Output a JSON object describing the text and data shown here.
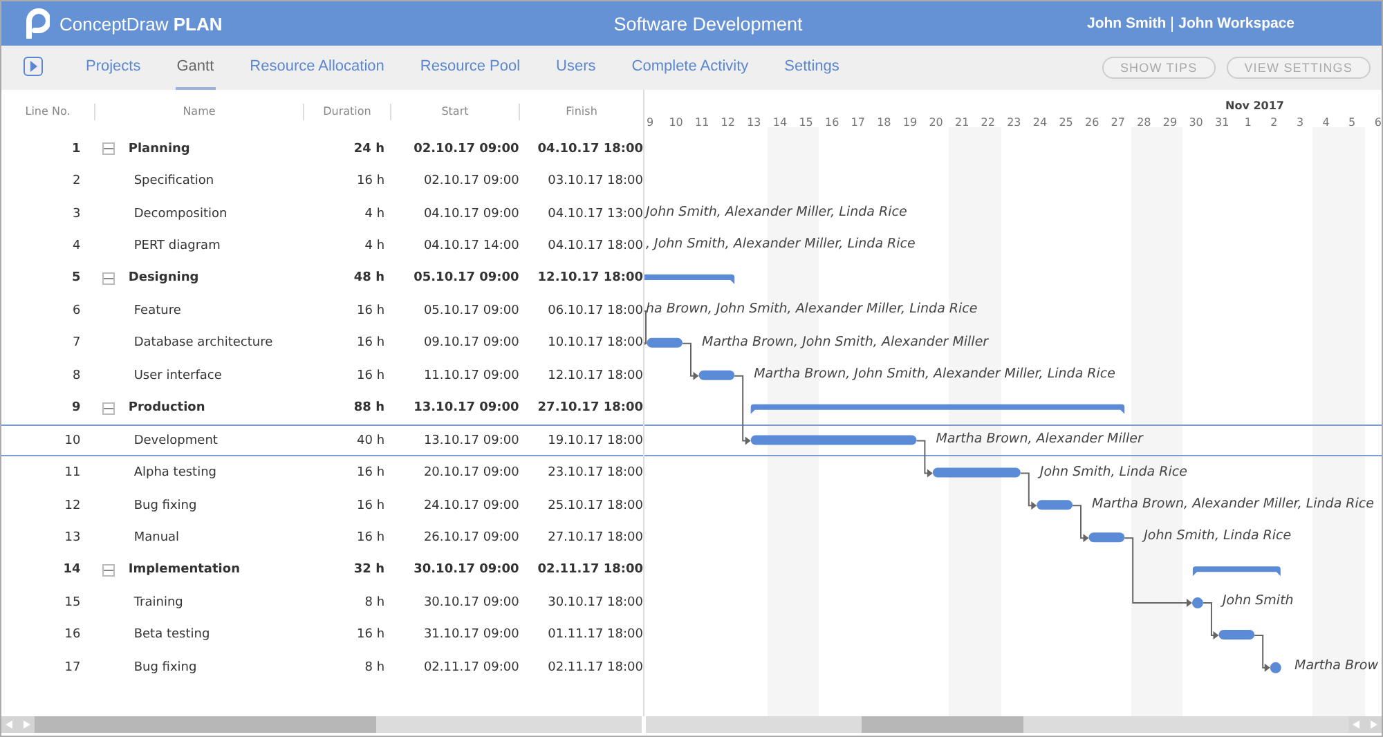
{
  "app": {
    "logo_text": "ConceptDraw",
    "logo_bold": "PLAN",
    "title": "Software Development",
    "user": "John Smith",
    "workspace": "John Workspace"
  },
  "nav": {
    "tabs": [
      {
        "label": "Projects",
        "selected": false
      },
      {
        "label": "Gantt",
        "selected": true
      },
      {
        "label": "Resource Allocation",
        "selected": false
      },
      {
        "label": "Resource Pool",
        "selected": false
      },
      {
        "label": "Users",
        "selected": false
      },
      {
        "label": "Complete Activity",
        "selected": false
      },
      {
        "label": "Settings",
        "selected": false
      }
    ],
    "buttons": [
      "SHOW TIPS",
      "VIEW SETTINGS"
    ]
  },
  "table": {
    "columns": [
      "Line No.",
      "Name",
      "Duration",
      "Start",
      "Finish"
    ],
    "rows": [
      {
        "line": "1",
        "name": "Planning",
        "duration": "24 h",
        "start": "02.10.17 09:00",
        "finish": "04.10.17 18:00",
        "kind": "summary",
        "expanded": true,
        "selected": false,
        "linked": false
      },
      {
        "line": "2",
        "name": "Specification",
        "duration": "16 h",
        "start": "02.10.17 09:00",
        "finish": "03.10.17 18:00",
        "kind": "task",
        "selected": false,
        "linked": false
      },
      {
        "line": "3",
        "name": "Decomposition",
        "duration": "4 h",
        "start": "04.10.17 09:00",
        "finish": "04.10.17 13:00",
        "kind": "task",
        "selected": false,
        "linked": false,
        "resources": "John Smith, Alexander Miller, Linda Rice"
      },
      {
        "line": "4",
        "name": "PERT diagram",
        "duration": "4 h",
        "start": "04.10.17 14:00",
        "finish": "04.10.17 18:00",
        "kind": "task",
        "selected": false,
        "linked": false,
        "resources": ", John Smith, Alexander Miller, Linda Rice"
      },
      {
        "line": "5",
        "name": "Designing",
        "duration": "48 h",
        "start": "05.10.17 09:00",
        "finish": "12.10.17 18:00",
        "kind": "summary",
        "expanded": true,
        "selected": false,
        "linked": false
      },
      {
        "line": "6",
        "name": "Feature",
        "duration": "16 h",
        "start": "05.10.17 09:00",
        "finish": "06.10.17 18:00",
        "kind": "task",
        "selected": false,
        "linked": false,
        "resources": "ha Brown, John Smith, Alexander Miller, Linda Rice"
      },
      {
        "line": "7",
        "name": "Database architecture",
        "duration": "16 h",
        "start": "09.10.17 09:00",
        "finish": "10.10.17 18:00",
        "kind": "task",
        "selected": false,
        "linked": true,
        "resources": "Martha Brown, John Smith, Alexander Miller"
      },
      {
        "line": "8",
        "name": "User interface",
        "duration": "16 h",
        "start": "11.10.17 09:00",
        "finish": "12.10.17 18:00",
        "kind": "task",
        "selected": false,
        "linked": true,
        "resources": "Martha Brown, John Smith, Alexander Miller, Linda Rice"
      },
      {
        "line": "9",
        "name": "Production",
        "duration": "88 h",
        "start": "13.10.17 09:00",
        "finish": "27.10.17 18:00",
        "kind": "summary",
        "expanded": true,
        "selected": false,
        "linked": false
      },
      {
        "line": "10",
        "name": "Development",
        "duration": "40 h",
        "start": "13.10.17 09:00",
        "finish": "19.10.17 18:00",
        "kind": "task",
        "selected": true,
        "linked": true,
        "resources": "Martha Brown, Alexander Miller"
      },
      {
        "line": "11",
        "name": "Alpha testing",
        "duration": "16 h",
        "start": "20.10.17 09:00",
        "finish": "23.10.17 18:00",
        "kind": "task",
        "selected": false,
        "linked": true,
        "resources": "John Smith, Linda Rice"
      },
      {
        "line": "12",
        "name": "Bug fixing",
        "duration": "16 h",
        "start": "24.10.17 09:00",
        "finish": "25.10.17 18:00",
        "kind": "task",
        "selected": false,
        "linked": true,
        "resources": "Martha Brown, Alexander Miller, Linda Rice"
      },
      {
        "line": "13",
        "name": "Manual",
        "duration": "16 h",
        "start": "26.10.17 09:00",
        "finish": "27.10.17 18:00",
        "kind": "task",
        "selected": false,
        "linked": true,
        "resources": "John Smith, Linda Rice"
      },
      {
        "line": "14",
        "name": "Implementation",
        "duration": "32 h",
        "start": "30.10.17 09:00",
        "finish": "02.11.17 18:00",
        "kind": "summary",
        "expanded": true,
        "selected": false,
        "linked": false
      },
      {
        "line": "15",
        "name": "Training",
        "duration": "8 h",
        "start": "30.10.17 09:00",
        "finish": "30.10.17 18:00",
        "kind": "milestone",
        "selected": false,
        "linked": true,
        "resources": "John Smith"
      },
      {
        "line": "16",
        "name": "Beta testing",
        "duration": "16 h",
        "start": "31.10.17 09:00",
        "finish": "01.11.17 18:00",
        "kind": "task",
        "selected": false,
        "linked": true
      },
      {
        "line": "17",
        "name": "Bug fixing",
        "duration": "8 h",
        "start": "02.11.17 09:00",
        "finish": "02.11.17 18:00",
        "kind": "milestone",
        "selected": false,
        "linked": true,
        "resources": "Martha Brow"
      }
    ]
  },
  "timeline": {
    "days": [
      {
        "label": "9",
        "weekend": false
      },
      {
        "label": "10",
        "weekend": false
      },
      {
        "label": "11",
        "weekend": false
      },
      {
        "label": "12",
        "weekend": false
      },
      {
        "label": "13",
        "weekend": false
      },
      {
        "label": "14",
        "weekend": true
      },
      {
        "label": "15",
        "weekend": true
      },
      {
        "label": "16",
        "weekend": false
      },
      {
        "label": "17",
        "weekend": false
      },
      {
        "label": "18",
        "weekend": false
      },
      {
        "label": "19",
        "weekend": false
      },
      {
        "label": "20",
        "weekend": false
      },
      {
        "label": "21",
        "weekend": true
      },
      {
        "label": "22",
        "weekend": true
      },
      {
        "label": "23",
        "weekend": false
      },
      {
        "label": "24",
        "weekend": false
      },
      {
        "label": "25",
        "weekend": false
      },
      {
        "label": "26",
        "weekend": false
      },
      {
        "label": "27",
        "weekend": false
      },
      {
        "label": "28",
        "weekend": true
      },
      {
        "label": "29",
        "weekend": true
      },
      {
        "label": "30",
        "weekend": false
      },
      {
        "label": "31",
        "weekend": false
      },
      {
        "label": "1",
        "weekend": false,
        "month": "Nov 2017"
      },
      {
        "label": "2",
        "weekend": false
      },
      {
        "label": "3",
        "weekend": false
      },
      {
        "label": "4",
        "weekend": true
      },
      {
        "label": "5",
        "weekend": true
      },
      {
        "label": "6",
        "weekend": false
      }
    ]
  }
}
